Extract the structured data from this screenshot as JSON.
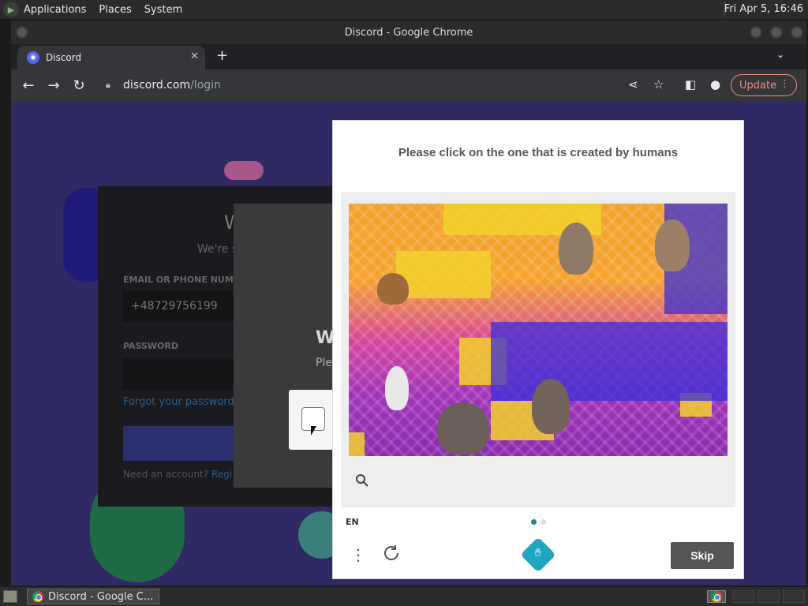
{
  "system_panel": {
    "menus": [
      "Applications",
      "Places",
      "System"
    ],
    "clock": "Fri Apr  5, 16:46"
  },
  "window": {
    "title": "Discord - Google Chrome"
  },
  "browser": {
    "tab_title": "Discord",
    "url_host": "discord.com",
    "url_path": "/login",
    "update_label": "Update"
  },
  "login": {
    "title_partial": "W",
    "subtitle_partial": "We're s",
    "email_label": "EMAIL OR PHONE NUMB",
    "email_value": "+48729756199",
    "password_label": "PASSWORD",
    "forgot": "Forgot your password?",
    "need_account": "Need an account?",
    "register_partial": "Regi"
  },
  "overlay": {
    "title_partial": "W",
    "sub_partial": "Ple"
  },
  "captcha": {
    "prompt": "Please click on the one that is created by humans",
    "language": "EN",
    "skip_label": "Skip",
    "page_index": 1,
    "page_count": 2
  },
  "taskbar": {
    "task_label": "Discord - Google C..."
  }
}
